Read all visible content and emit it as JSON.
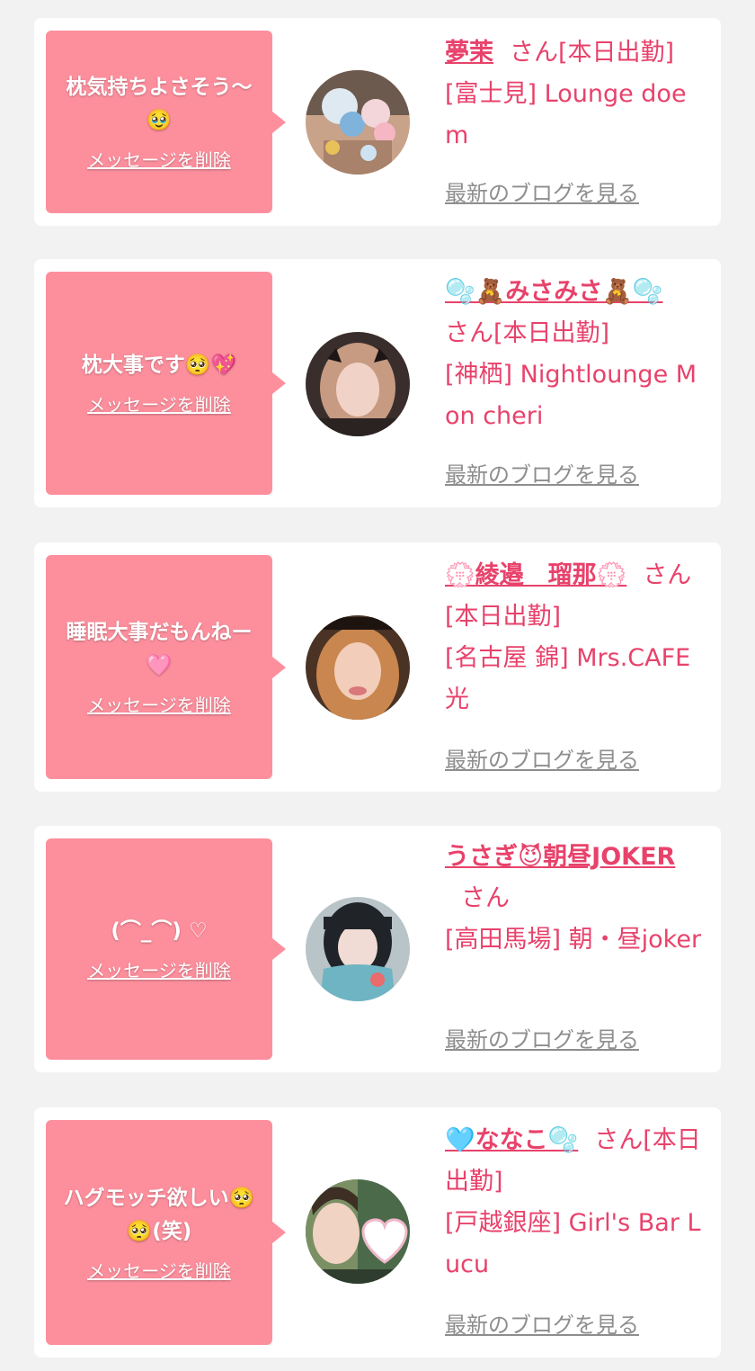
{
  "delete_label": "メッセージを削除",
  "blog_label": "最新のブログを見る",
  "cards": [
    {
      "message": "枕気持ちよさそう〜🥹",
      "name": "夢茉",
      "suffix": "さん[本日出勤]",
      "shop": "[富士見] Lounge doem"
    },
    {
      "message": "枕大事です🥺💖",
      "name": "🫧🧸みさみさ🧸🫧",
      "suffix": "さん[本日出勤]",
      "shop": "[神栖] Nightlounge Mon cheri"
    },
    {
      "message": "睡眠大事だもんねー🩷",
      "name": "💮綾邉　瑠那💮",
      "suffix": "さん[本日出勤]",
      "shop": "[名古屋 錦] Mrs.CAFE 光"
    },
    {
      "message": "(⌒_⌒) ♡",
      "name": "うさぎ😈朝昼JOKER",
      "suffix": "さん",
      "shop": "[高田馬場] 朝・昼joker"
    },
    {
      "message": "ハグモッチ欲しい🥺🥺(笑)",
      "name": "🩵ななこ🫧",
      "suffix": "さん[本日出勤]",
      "shop": "[戸越銀座] Girl's Bar Lucu"
    }
  ],
  "colors": {
    "page_bg": "#f2f2f2",
    "card_bg": "#ffffff",
    "bubble_bg": "#fd8f9d",
    "accent_text": "#e8426b",
    "link_gray": "#8e8e8e"
  }
}
